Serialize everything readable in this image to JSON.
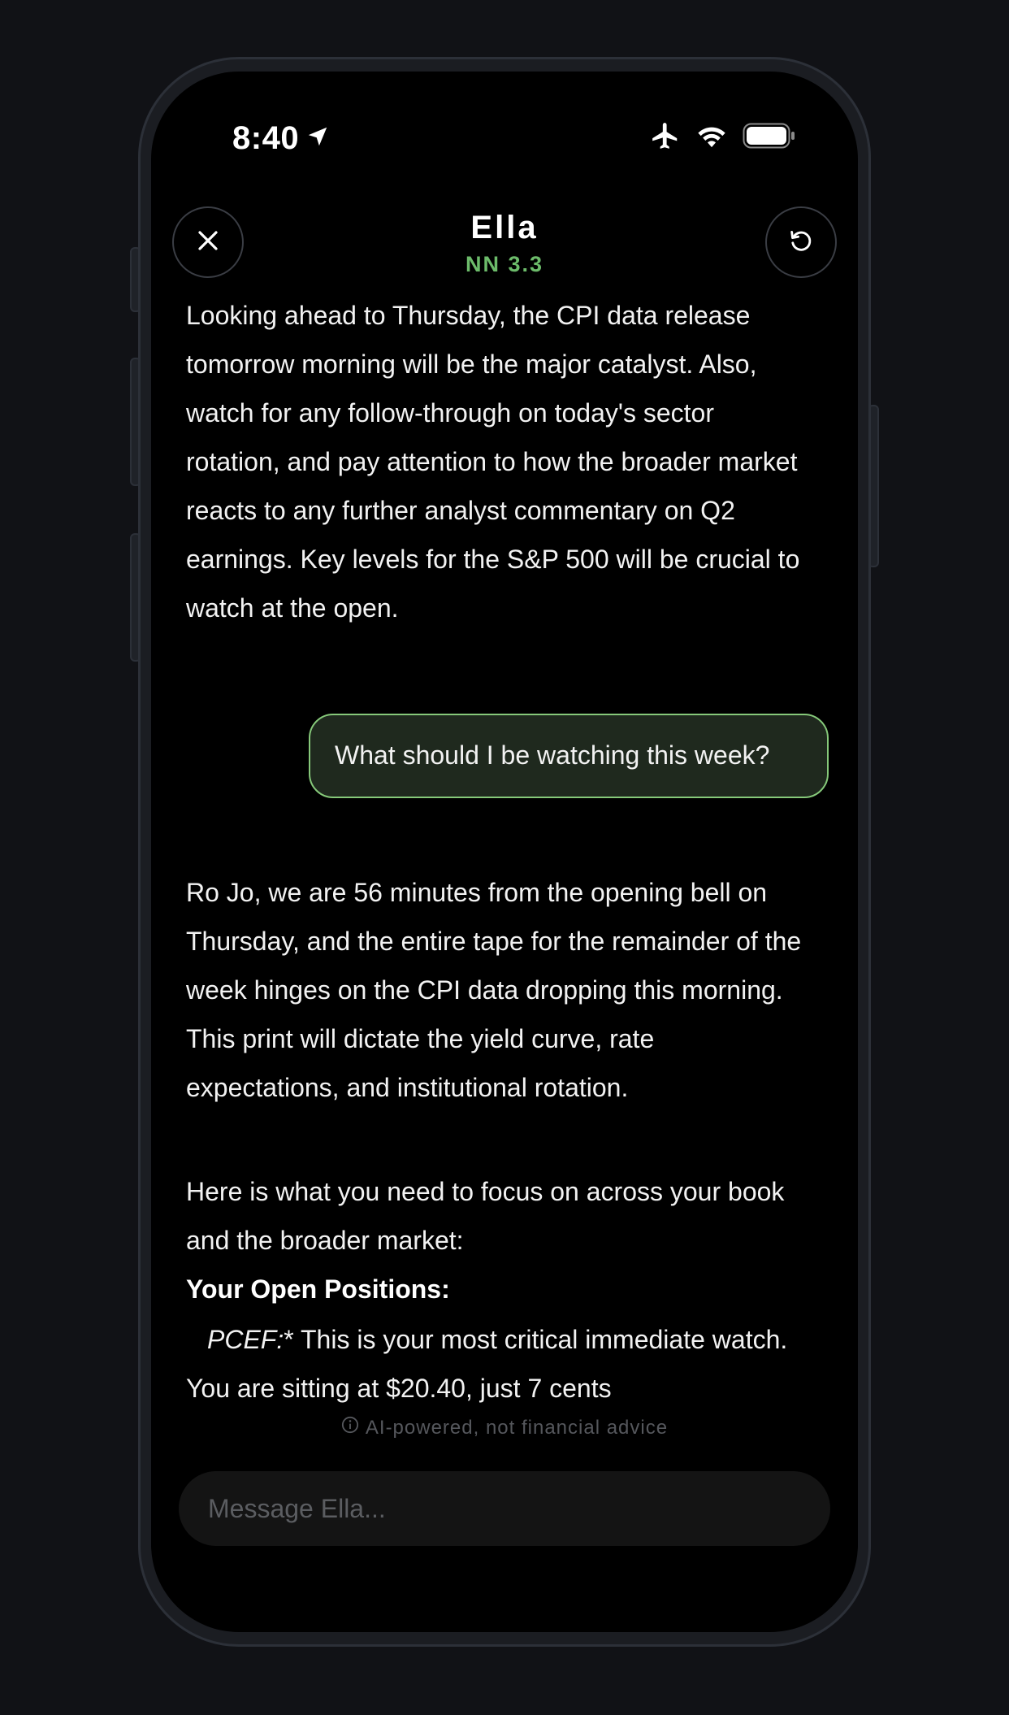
{
  "status_bar": {
    "time": "8:40"
  },
  "header": {
    "title": "Ella",
    "model": "NN 3.3"
  },
  "messages": {
    "ai_previous": "Looking ahead to Thursday, the CPI data release tomorrow morning will be the major catalyst. Also, watch for any follow-through on today's sector rotation, and pay attention to how the broader market reacts to any further analyst commentary on Q2 earnings. Key levels for the S&P 500 will be crucial to watch at the open.",
    "user_question": "What should I be watching this week?",
    "ai_reply_p1": "Ro Jo, we are 56 minutes from the opening bell on Thursday, and the entire tape for the remainder of the week hinges on the CPI data dropping this morning. This print will dictate the yield curve, rate expectations, and institutional rotation.",
    "ai_reply_p2": "Here is what you need to focus on across your book and the broader market:",
    "ai_reply_heading": "Your Open Positions:",
    "ai_reply_bullet_ticker": "PCEF:",
    "ai_reply_bullet_rest": "* This is your most critical immediate watch. You are sitting at $20.40, just 7 cents"
  },
  "footer": {
    "disclaimer": "AI-powered, not financial advice"
  },
  "composer": {
    "placeholder": "Message Ella..."
  },
  "colors": {
    "accent_green": "#6cbb6a",
    "bubble_border": "#86c97a",
    "bubble_bg": "#1f291e",
    "background": "#000000"
  },
  "icons": {
    "location": "location-arrow-icon",
    "airplane": "airplane-mode-icon",
    "wifi": "wifi-icon",
    "battery": "battery-icon",
    "close": "close-icon",
    "reset": "refresh-icon",
    "info": "info-icon"
  }
}
